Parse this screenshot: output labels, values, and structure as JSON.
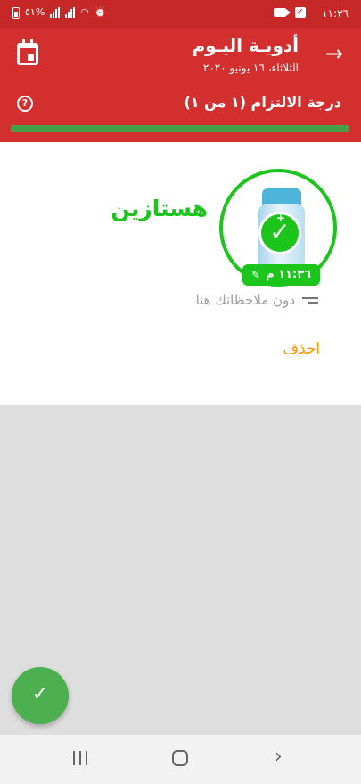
{
  "status_bar": {
    "time": "١١:٣٦",
    "battery_percent": "٥١%",
    "icons": [
      "video-icon",
      "check-box-icon",
      "alarm-icon",
      "wifi-icon",
      "signal-icon",
      "battery-icon"
    ]
  },
  "header": {
    "title": "أدويـة اليـوم",
    "subtitle": "الثلاثاء، ١٦ يونيو ٢٠٢٠",
    "adherence_label": "درجة الالتزام (١ من ١)",
    "adherence_fraction": 1.0,
    "help_glyph": "?"
  },
  "medication": {
    "name": "هستازين",
    "time": "١١:٣٦ م",
    "notes_placeholder": "دون ملاحظاتك هنا",
    "delete_label": "احذف",
    "taken": true
  },
  "colors": {
    "header": "#d32f2f",
    "status_bar": "#c62828",
    "accent_green": "#1cc51c",
    "progress": "#43a047",
    "delete": "#ff9800"
  }
}
